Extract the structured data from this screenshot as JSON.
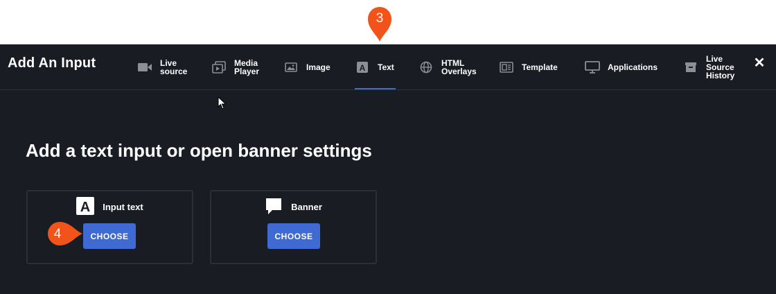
{
  "dialog": {
    "title": "Add An Input",
    "close_glyph": "✕",
    "tabs": [
      {
        "line1": "Live",
        "line2": "source",
        "icon": "camera-icon"
      },
      {
        "line1": "Media",
        "line2": "Player",
        "icon": "media-player-icon"
      },
      {
        "line1": "Image",
        "line2": "",
        "icon": "image-icon"
      },
      {
        "line1": "Text",
        "line2": "",
        "icon": "text-icon",
        "active": true
      },
      {
        "line1": "HTML",
        "line2": "Overlays",
        "icon": "globe-icon"
      },
      {
        "line1": "Template",
        "line2": "",
        "icon": "template-icon"
      },
      {
        "line1": "Applications",
        "line2": "",
        "icon": "monitor-icon"
      },
      {
        "line1": "Live",
        "line2": "Source",
        "line3": "History",
        "icon": "archive-icon"
      }
    ]
  },
  "main": {
    "heading": "Add a text input or open banner settings",
    "cards": [
      {
        "title": "Input text",
        "icon_letter": "A",
        "button": "CHOOSE"
      },
      {
        "title": "Banner",
        "button": "CHOOSE"
      }
    ]
  },
  "annotations": {
    "step3": "3",
    "step4": "4"
  },
  "colors": {
    "dialog_bg": "#191c23",
    "accent": "#3e6ad1",
    "marker": "#f2531b",
    "icon_gray": "#8a8f98"
  }
}
